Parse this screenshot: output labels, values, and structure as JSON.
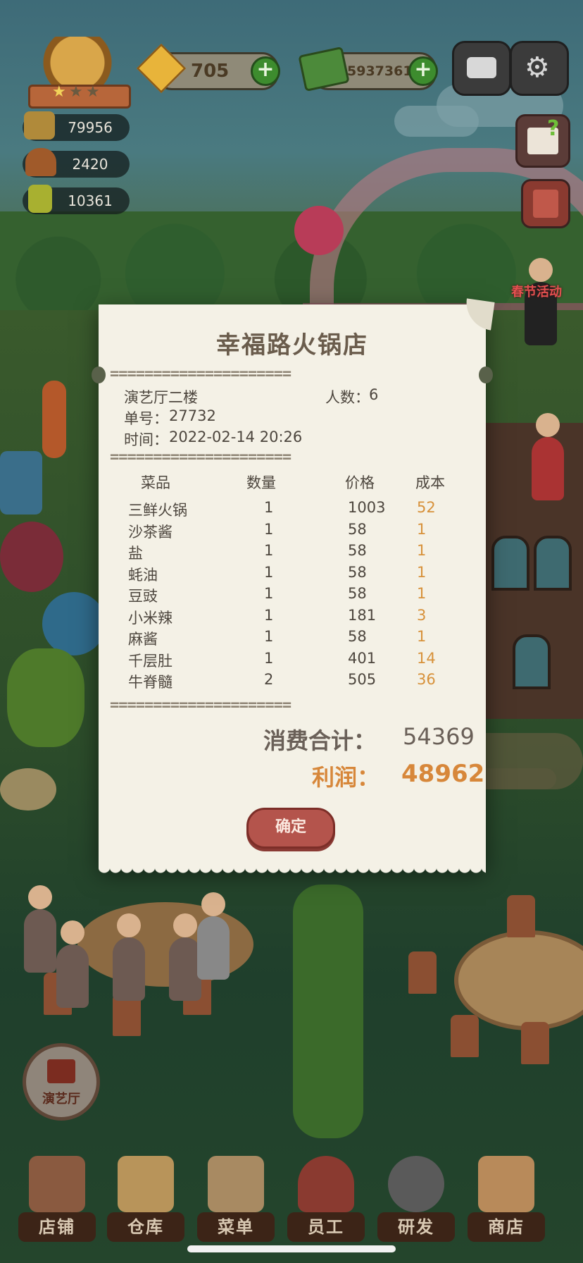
{
  "hud": {
    "gems": "705",
    "cash": "59373618",
    "stat_1": "79956",
    "stat_2": "2420",
    "stat_3": "10361",
    "event_label": "春节活动"
  },
  "receipt": {
    "title": "幸福路火锅店",
    "location": "演艺厅二楼",
    "guests_label": "人数：",
    "guests": "6",
    "order_label": "单号：",
    "order_no": "27732",
    "time_label": "时间：",
    "time": "2022-02-14 20:26",
    "divider": "=====================",
    "headers": {
      "dish": "菜品",
      "qty": "数量",
      "price": "价格",
      "cost": "成本"
    },
    "items": [
      {
        "name": "三鲜火锅",
        "qty": "1",
        "price": "1003",
        "cost": "52"
      },
      {
        "name": "沙茶酱",
        "qty": "1",
        "price": "58",
        "cost": "1"
      },
      {
        "name": "盐",
        "qty": "1",
        "price": "58",
        "cost": "1"
      },
      {
        "name": "蚝油",
        "qty": "1",
        "price": "58",
        "cost": "1"
      },
      {
        "name": "豆豉",
        "qty": "1",
        "price": "58",
        "cost": "1"
      },
      {
        "name": "小米辣",
        "qty": "1",
        "price": "181",
        "cost": "3"
      },
      {
        "name": "麻酱",
        "qty": "1",
        "price": "58",
        "cost": "1"
      },
      {
        "name": "千层肚",
        "qty": "1",
        "price": "401",
        "cost": "14"
      },
      {
        "name": "牛脊髓",
        "qty": "2",
        "price": "505",
        "cost": "36"
      }
    ],
    "total_label": "消费合计：",
    "total": "54369",
    "profit_label": "利润：",
    "profit": "48962",
    "confirm_label": "确定"
  },
  "hall_button": {
    "label": "演艺厅"
  },
  "nav": [
    {
      "id": "shop",
      "label": "店铺"
    },
    {
      "id": "warehouse",
      "label": "仓库"
    },
    {
      "id": "menu",
      "label": "菜单"
    },
    {
      "id": "staff",
      "label": "员工"
    },
    {
      "id": "research",
      "label": "研发"
    },
    {
      "id": "store",
      "label": "商店"
    }
  ],
  "colors": {
    "receipt_bg": "#f4f1e6",
    "cost_text": "#d7913a",
    "profit_text": "#d7873a",
    "confirm_button": "#b4544c",
    "plus_button": "#3d8c2e"
  }
}
